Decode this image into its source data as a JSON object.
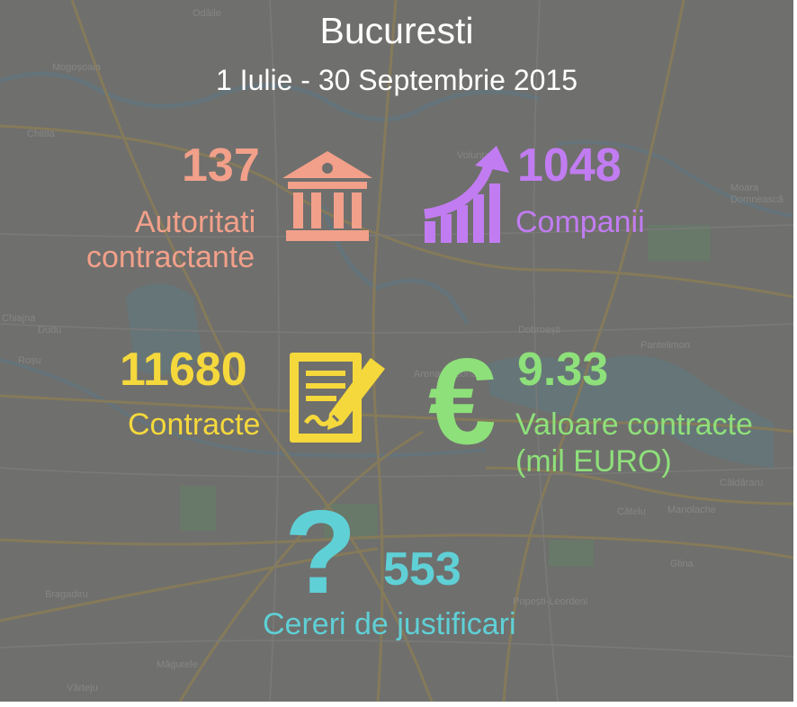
{
  "header": {
    "city": "Bucuresti",
    "period": "1 Iulie - 30 Septembrie 2015"
  },
  "stats": {
    "authorities": {
      "value": "137",
      "label_line1": "Autoritati",
      "label_line2": "contractante",
      "color": "#f2a08a",
      "icon": "bank-building-icon"
    },
    "companies": {
      "value": "1048",
      "label": "Companii",
      "color": "#c27cf2",
      "icon": "growth-chart-icon"
    },
    "contracts": {
      "value": "11680",
      "label": "Contracte",
      "color": "#f5d83c",
      "icon": "contract-signature-icon"
    },
    "contract_value": {
      "value": "9.33",
      "label_line1": "Valoare contracte",
      "label_line2": "(mil EURO)",
      "color": "#8ee07a",
      "icon": "euro-icon"
    },
    "justifications": {
      "value": "553",
      "label": "Cereri de justificari",
      "color": "#5fd0d6",
      "icon": "question-mark-icon"
    }
  },
  "map_labels": [
    "Odăile",
    "Mogoșoaia",
    "Chitila",
    "Voluntari",
    "Moara Domnească",
    "Dudu",
    "Chiajna",
    "Roșu",
    "Dobroești",
    "Pantelimon",
    "Arena Națională",
    "București",
    "Căldăraru",
    "Cătelu",
    "Manolache",
    "Glina",
    "Bragadiru",
    "Popești-Leordeni",
    "Măgurele",
    "Vârteju"
  ]
}
